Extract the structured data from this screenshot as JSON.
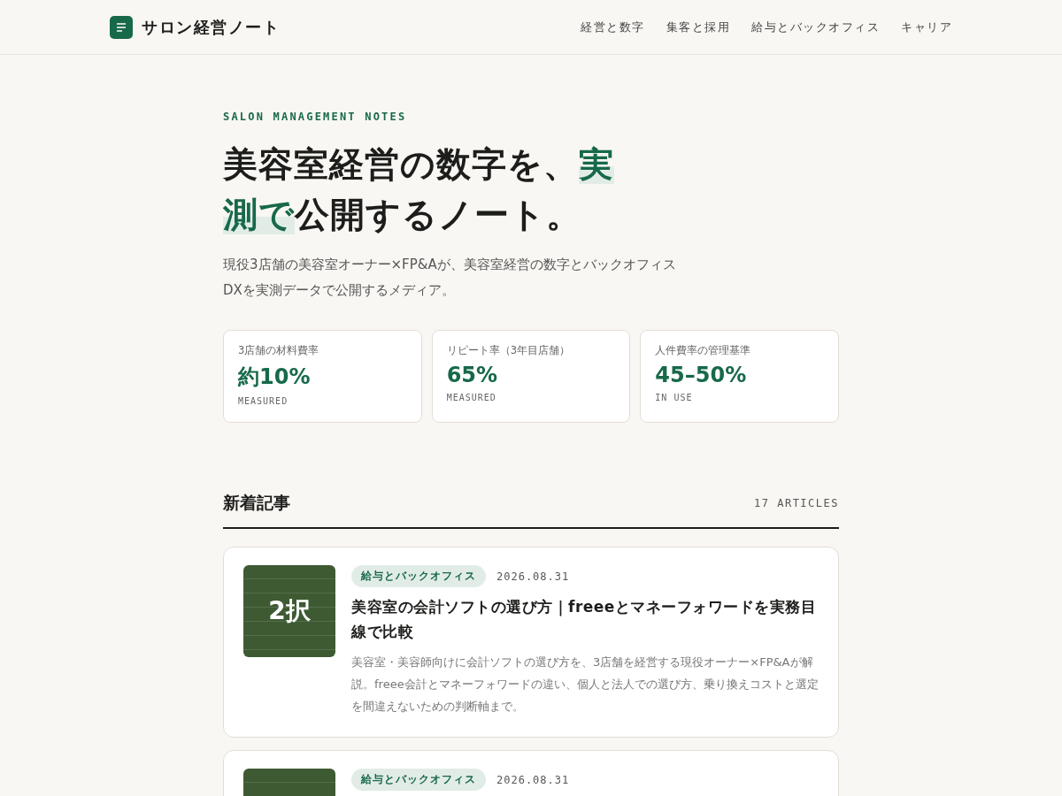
{
  "header": {
    "logo": "サロン経営ノート",
    "nav": [
      {
        "label": "経営と数字"
      },
      {
        "label": "集客と採用"
      },
      {
        "label": "給与とバックオフィス"
      },
      {
        "label": "キャリア"
      }
    ]
  },
  "hero": {
    "eyebrow": "SALON MANAGEMENT NOTES",
    "headline": [
      {
        "text": "美容室経営の数字を、",
        "emphasis": false
      },
      {
        "text": "実測で",
        "emphasis": true
      },
      {
        "text": "公開するノート。",
        "emphasis": false
      }
    ],
    "lead": "現役3店舗の美容室オーナー×FP&Aが、美容室経営の数字とバックオフィスDXを実測データで公開するメディア。"
  },
  "stats": [
    {
      "label": "3店舗の材料費率",
      "value": "約10%",
      "note": "MEASURED"
    },
    {
      "label": "リピート率（3年目店舗）",
      "value": "65%",
      "note": "MEASURED"
    },
    {
      "label": "人件費率の管理基準",
      "value": "45–50%",
      "note": "IN USE"
    }
  ],
  "articles_section": {
    "title": "新着記事",
    "count": "17 ARTICLES",
    "articles": [
      {
        "thumb_text": "2択",
        "tag": "給与とバックオフィス",
        "date": "2026.08.31",
        "title": "美容室の会計ソフトの選び方｜freeeとマネーフォワードを実務目線で比較",
        "summary": "美容室・美容師向けに会計ソフトの選び方を、3店舗を経営する現役オーナー×FP&Aが解説。freee会計とマネーフォワードの違い、個人と法人での選び方、乗り換えコストと選定を間違えないための判断軸まで。"
      },
      {
        "tag": "給与とバックオフィス",
        "date": "2026.08.31"
      }
    ]
  }
}
